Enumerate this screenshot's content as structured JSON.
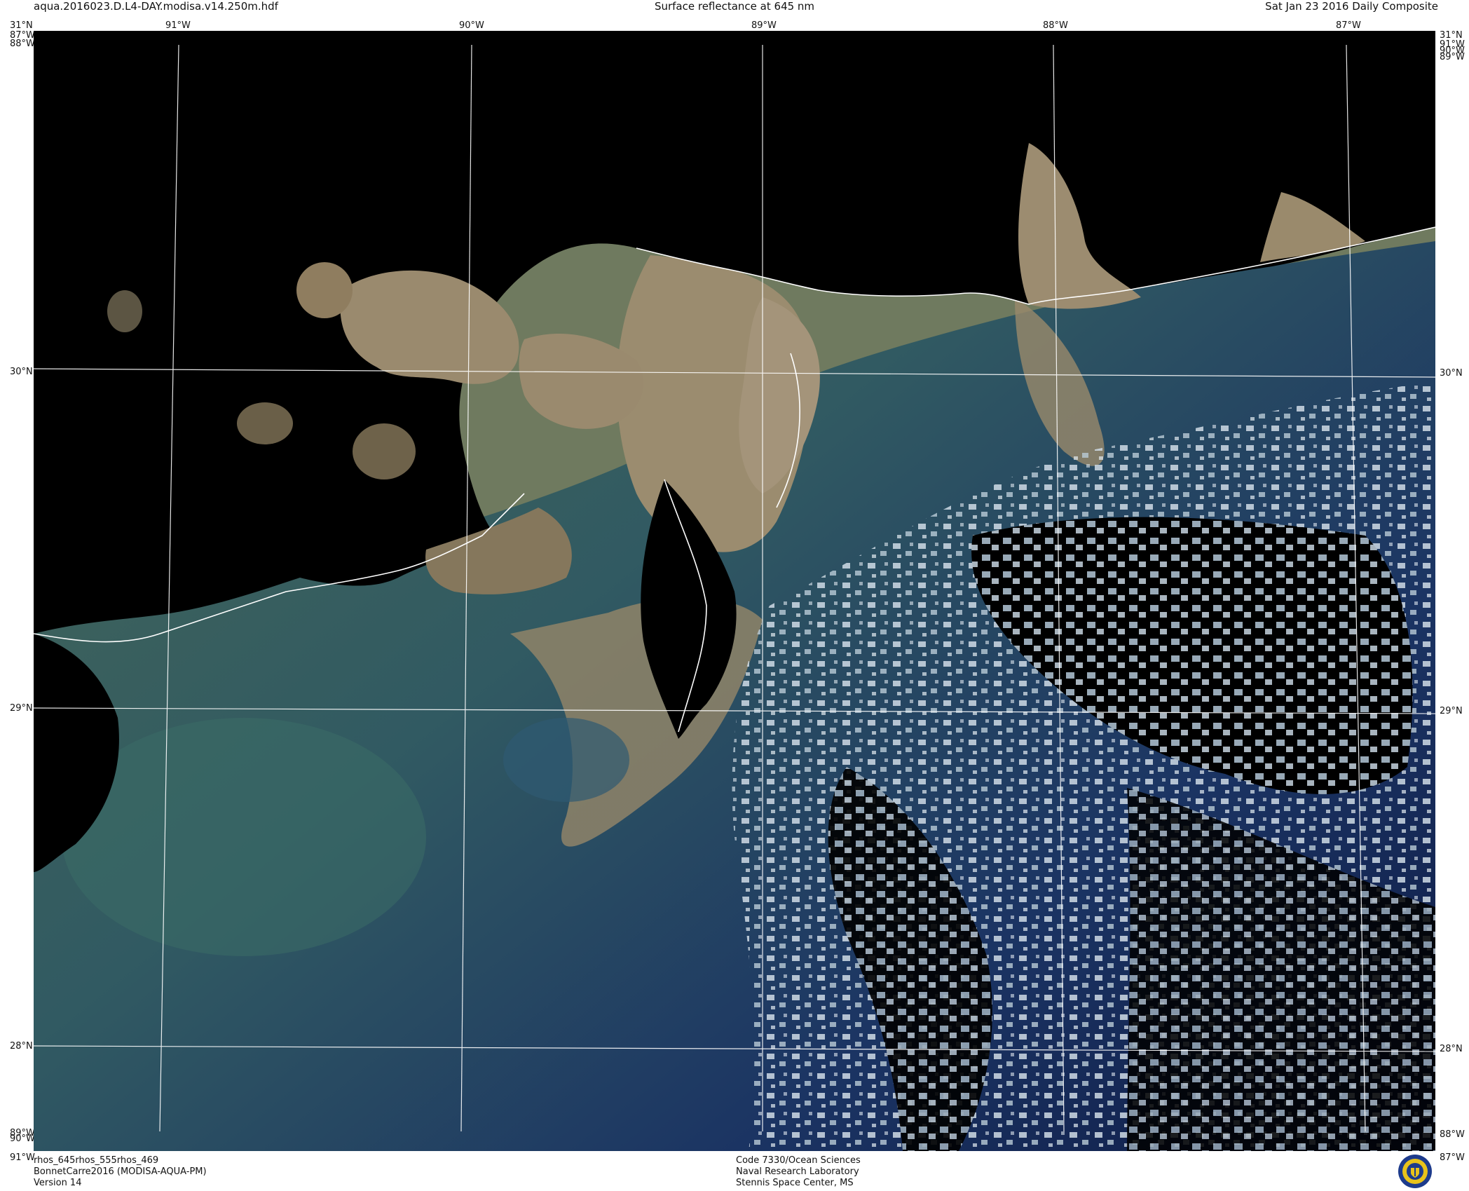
{
  "header": {
    "filename": "aqua.2016023.D.L4-DAY.modisa.v14.250m.hdf",
    "product": "Surface reflectance at 645 nm",
    "date": "Sat Jan 23 2016 Daily Composite"
  },
  "grid": {
    "top_lon": [
      "91°W",
      "90°W",
      "89°W",
      "88°W",
      "87°W"
    ],
    "side_lat": [
      "31°N",
      "30°N",
      "29°N",
      "28°N"
    ],
    "top_left_corner": "31°N",
    "top_left_corner_lon": "87°W",
    "top_left_extra": "88°W",
    "top_right_corner": "31°N",
    "top_right_lon": "91°W",
    "top_right_extra": "90°W",
    "top_right_extra2": "89°W",
    "bottom_left_lon": "89°W",
    "bottom_left_extra": "90°W",
    "bottom_left_corner": "91°W",
    "bottom_right_lon": "88°W",
    "bottom_right_corner": "87°W"
  },
  "footer": {
    "bands": "rhos_645rhos_555rhos_469",
    "project": "BonnetCarre2016 (MODISA-AQUA-PM)",
    "version": "Version 14",
    "code": "Code 7330/Ocean Sciences",
    "lab": "Naval Research Laboratory",
    "location": "Stennis Space Center, MS"
  },
  "colors": {
    "land": "#000000",
    "sediment": "#9a8a6e",
    "turbid_green": "#4e6a52",
    "coastal_teal": "#3d6e72",
    "deep_ocean": "#0e1a45",
    "clouds": "#c9d6e0",
    "grid_lines": "#ffffff",
    "coastline": "#ffffff"
  },
  "seal_icon": "navy-research-lab-seal-icon"
}
